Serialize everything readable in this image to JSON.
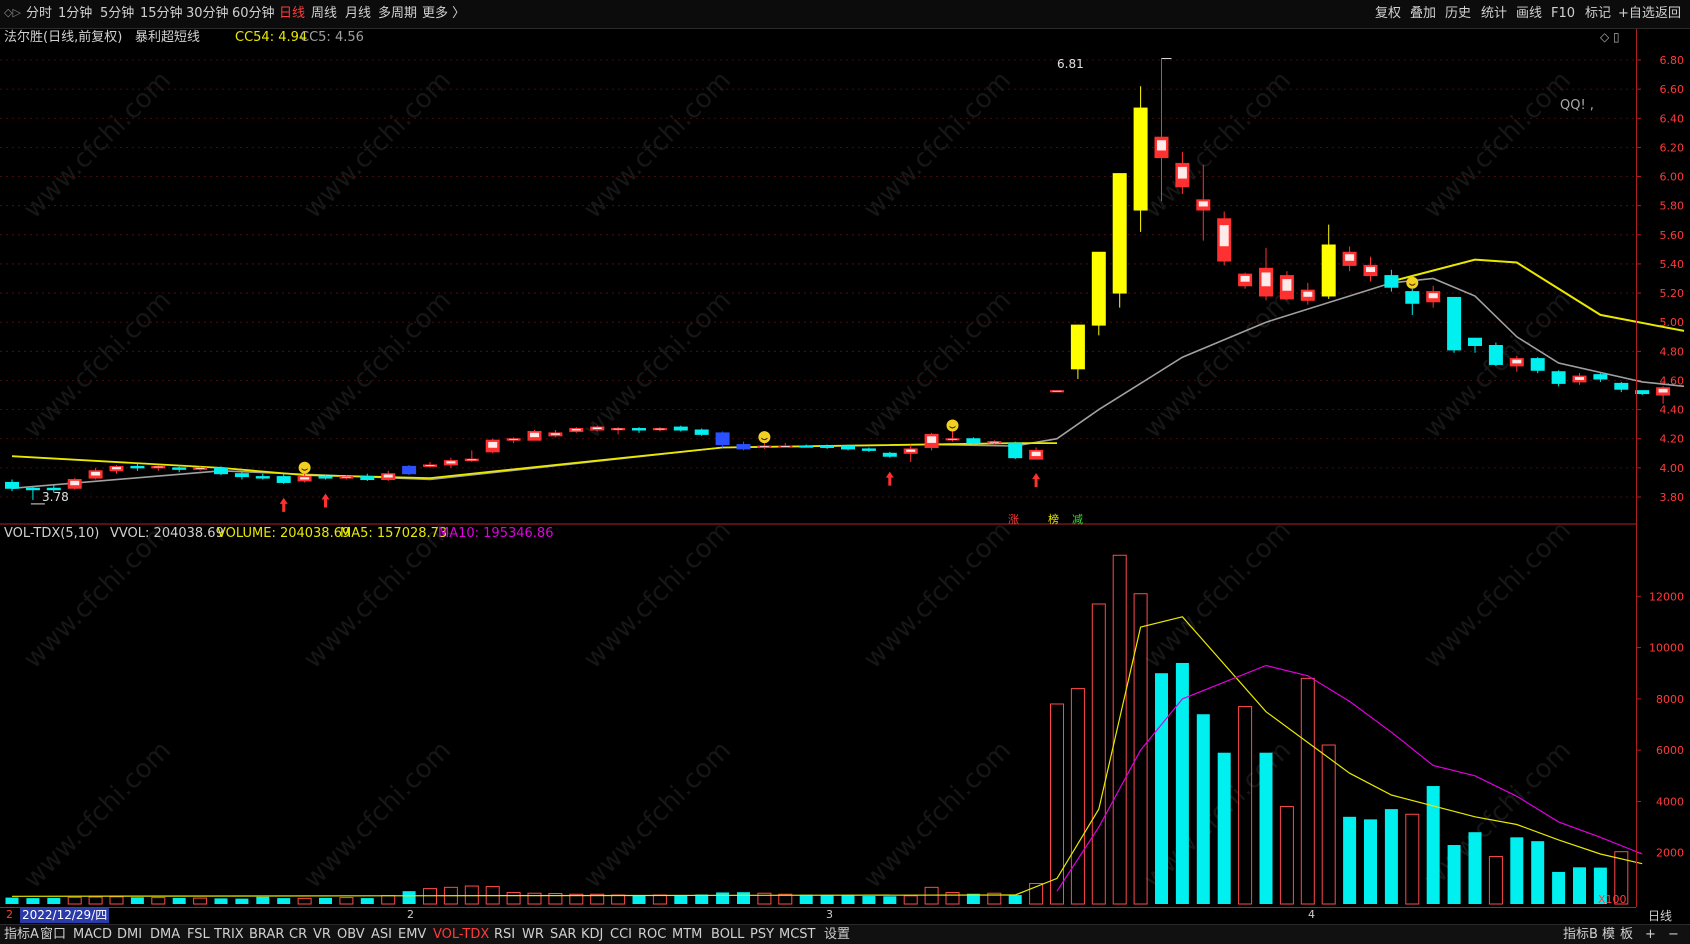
{
  "topbar": {
    "left_toggle": "◇▷",
    "periods": [
      "分时",
      "1分钟",
      "5分钟",
      "15分钟",
      "30分钟",
      "60分钟",
      "日线",
      "周线",
      "月线",
      "多周期",
      "更多 〉"
    ],
    "active_period": "日线",
    "tools": [
      "复权",
      "叠加",
      "历史",
      "统计",
      "画线",
      "F10",
      "标记",
      "+自选",
      "返回"
    ]
  },
  "info": {
    "stock_title": "法尔胜(日线,前复权)",
    "indicator_name": "暴利超短线",
    "cc54_label": "CC54: 4.94",
    "cc5_label": "CC5: 4.56",
    "qq_note": "QQ!  ,",
    "high_label": "6.81",
    "low_label": "3.78",
    "right_icons": "◇ ▯"
  },
  "price_axis": [
    "6.80",
    "6.60",
    "6.40",
    "6.20",
    "6.00",
    "5.80",
    "5.60",
    "5.40",
    "5.20",
    "5.00",
    "4.80",
    "4.60",
    "4.40",
    "4.20",
    "4.00",
    "3.80"
  ],
  "vol_axis": [
    "12000",
    "10000",
    "8000",
    "6000",
    "4000",
    "2000"
  ],
  "vol_unit": "X100",
  "flags": [
    "涨",
    "榜",
    "减"
  ],
  "vol_info": {
    "name": "VOL-TDX(5,10)",
    "vvol": "VVOL: 204038.69",
    "volume": "VOLUME: 204038.69",
    "ma5": "MA5: 157028.73",
    "ma10": "MA10: 195346.86"
  },
  "date_axis": {
    "selected_date": "2022/12/29/四",
    "month_ticks": [
      "2",
      "3",
      "4"
    ],
    "left_mark": "2"
  },
  "bottombar": {
    "items": [
      "指标A",
      "窗口",
      "MACD",
      "DMI",
      "DMA",
      "FSL",
      "TRIX",
      "BRAR",
      "CR",
      "VR",
      "OBV",
      "ASI",
      "EMV",
      "VOL-TDX",
      "RSI",
      "WR",
      "SAR",
      "KDJ",
      "CCI",
      "ROC",
      "MTM",
      "BOLL",
      "PSY",
      "MCST",
      "设置"
    ],
    "active_item": "VOL-TDX",
    "right_items": [
      "指标B",
      "模",
      "板",
      "+",
      "−"
    ],
    "period_label": "日线"
  },
  "watermark": "www.cfchi.com",
  "colors": {
    "up": "#ff3030",
    "down": "#00f0f0",
    "limit_up": "#ffff00",
    "ma_gray": "#a0a0a0",
    "ma_yellow": "#e8e800",
    "ma10_magenta": "#e000e0"
  },
  "chart_data": [
    {
      "type": "candlestick",
      "title": "法尔胜(日线,前复权)",
      "ylim": [
        3.7,
        6.85
      ],
      "candles": [
        [
          3.9,
          3.86,
          3.92,
          3.84,
          "d"
        ],
        [
          3.86,
          3.85,
          3.87,
          3.78,
          "d"
        ],
        [
          3.85,
          3.86,
          3.88,
          3.83,
          "d"
        ],
        [
          3.86,
          3.92,
          3.93,
          3.85,
          "u"
        ],
        [
          3.93,
          3.98,
          4.0,
          3.92,
          "u"
        ],
        [
          3.98,
          4.01,
          4.02,
          3.96,
          "u"
        ],
        [
          4.01,
          4.0,
          4.03,
          3.98,
          "d"
        ],
        [
          4.0,
          4.01,
          4.02,
          3.98,
          "u"
        ],
        [
          4.0,
          3.99,
          4.02,
          3.97,
          "d"
        ],
        [
          3.99,
          4.0,
          4.01,
          3.98,
          "u"
        ],
        [
          4.0,
          3.96,
          4.01,
          3.95,
          "d"
        ],
        [
          3.96,
          3.94,
          3.97,
          3.92,
          "d"
        ],
        [
          3.94,
          3.93,
          3.96,
          3.92,
          "d"
        ],
        [
          3.94,
          3.9,
          3.96,
          3.89,
          "d"
        ],
        [
          3.91,
          3.94,
          3.96,
          3.9,
          "u"
        ],
        [
          3.94,
          3.93,
          3.95,
          3.92,
          "d"
        ],
        [
          3.93,
          3.94,
          3.95,
          3.92,
          "u"
        ],
        [
          3.94,
          3.92,
          3.96,
          3.91,
          "d"
        ],
        [
          3.92,
          3.96,
          3.98,
          3.91,
          "u"
        ],
        [
          3.96,
          4.01,
          4.02,
          3.95,
          "b"
        ],
        [
          4.01,
          4.02,
          4.04,
          4.0,
          "u"
        ],
        [
          4.02,
          4.05,
          4.07,
          4.0,
          "u"
        ],
        [
          4.05,
          4.06,
          4.12,
          4.04,
          "u"
        ],
        [
          4.11,
          4.19,
          4.2,
          4.1,
          "u"
        ],
        [
          4.19,
          4.2,
          4.21,
          4.17,
          "u"
        ],
        [
          4.19,
          4.25,
          4.26,
          4.19,
          "u"
        ],
        [
          4.22,
          4.24,
          4.26,
          4.21,
          "u"
        ],
        [
          4.25,
          4.27,
          4.28,
          4.24,
          "u"
        ],
        [
          4.26,
          4.28,
          4.29,
          4.25,
          "u"
        ],
        [
          4.27,
          4.27,
          4.28,
          4.23,
          "u"
        ],
        [
          4.27,
          4.26,
          4.28,
          4.24,
          "d"
        ],
        [
          4.27,
          4.27,
          4.28,
          4.25,
          "u"
        ],
        [
          4.28,
          4.26,
          4.29,
          4.25,
          "d"
        ],
        [
          4.26,
          4.23,
          4.27,
          4.22,
          "d"
        ],
        [
          4.24,
          4.16,
          4.25,
          4.14,
          "b"
        ],
        [
          4.16,
          4.13,
          4.18,
          4.12,
          "b"
        ],
        [
          4.14,
          4.15,
          4.17,
          4.13,
          "u"
        ],
        [
          4.15,
          4.15,
          4.17,
          4.14,
          "u"
        ],
        [
          4.15,
          4.15,
          4.16,
          4.14,
          "d"
        ],
        [
          4.15,
          4.14,
          4.16,
          4.13,
          "d"
        ],
        [
          4.15,
          4.13,
          4.16,
          4.12,
          "d"
        ],
        [
          4.13,
          4.12,
          4.14,
          4.11,
          "d"
        ],
        [
          4.1,
          4.08,
          4.11,
          4.07,
          "d"
        ],
        [
          4.1,
          4.13,
          4.16,
          4.04,
          "u"
        ],
        [
          4.14,
          4.23,
          4.24,
          4.12,
          "u"
        ],
        [
          4.2,
          4.2,
          4.25,
          4.18,
          "u"
        ],
        [
          4.2,
          4.17,
          4.21,
          4.16,
          "d"
        ],
        [
          4.18,
          4.18,
          4.19,
          4.16,
          "u"
        ],
        [
          4.17,
          4.07,
          4.18,
          4.06,
          "d"
        ],
        [
          4.06,
          4.12,
          4.14,
          4.06,
          "u"
        ],
        [
          4.53,
          4.53,
          4.53,
          4.53,
          "u"
        ],
        [
          4.68,
          4.98,
          4.98,
          4.61,
          "y"
        ],
        [
          4.98,
          5.48,
          5.48,
          4.91,
          "y"
        ],
        [
          5.2,
          6.02,
          6.02,
          5.1,
          "y"
        ],
        [
          5.77,
          6.47,
          6.62,
          5.62,
          "y"
        ],
        [
          6.27,
          6.13,
          6.81,
          5.83,
          "u"
        ],
        [
          6.09,
          5.93,
          6.17,
          5.88,
          "u"
        ],
        [
          5.84,
          5.77,
          6.08,
          5.56,
          "u"
        ],
        [
          5.71,
          5.42,
          5.76,
          5.39,
          "u"
        ],
        [
          5.33,
          5.25,
          5.34,
          5.23,
          "u"
        ],
        [
          5.37,
          5.18,
          5.51,
          5.15,
          "u"
        ],
        [
          5.32,
          5.16,
          5.35,
          5.15,
          "u"
        ],
        [
          5.22,
          5.15,
          5.27,
          5.12,
          "u"
        ],
        [
          5.53,
          5.18,
          5.67,
          5.16,
          "y"
        ],
        [
          5.48,
          5.39,
          5.52,
          5.35,
          "u"
        ],
        [
          5.39,
          5.32,
          5.45,
          5.28,
          "u"
        ],
        [
          5.32,
          5.24,
          5.36,
          5.21,
          "d"
        ],
        [
          5.21,
          5.13,
          5.23,
          5.05,
          "d"
        ],
        [
          5.21,
          5.14,
          5.25,
          5.1,
          "u"
        ],
        [
          5.17,
          4.81,
          5.17,
          4.79,
          "d"
        ],
        [
          4.89,
          4.84,
          4.89,
          4.79,
          "d"
        ],
        [
          4.84,
          4.71,
          4.86,
          4.7,
          "d"
        ],
        [
          4.75,
          4.7,
          4.77,
          4.66,
          "u"
        ],
        [
          4.75,
          4.67,
          4.76,
          4.65,
          "d"
        ],
        [
          4.66,
          4.58,
          4.67,
          4.56,
          "d"
        ],
        [
          4.63,
          4.59,
          4.65,
          4.57,
          "u"
        ],
        [
          4.64,
          4.61,
          4.65,
          4.59,
          "d"
        ],
        [
          4.58,
          4.54,
          4.59,
          4.52,
          "d"
        ],
        [
          4.53,
          4.51,
          4.53,
          4.5,
          "d"
        ],
        [
          4.55,
          4.5,
          4.56,
          4.44,
          "u"
        ]
      ],
      "series": [
        {
          "name": "CC54",
          "values_note": "yellow line"
        },
        {
          "name": "CC5",
          "values_note": "gray line"
        }
      ],
      "cc5_line": [
        [
          0,
          3.86
        ],
        [
          10,
          3.98
        ],
        [
          20,
          3.92
        ],
        [
          34,
          4.14
        ],
        [
          44,
          4.16
        ],
        [
          48,
          4.15
        ],
        [
          50,
          4.2
        ],
        [
          52,
          4.4
        ],
        [
          56,
          4.76
        ],
        [
          60,
          5.0
        ],
        [
          66,
          5.27
        ],
        [
          68,
          5.3
        ],
        [
          70,
          5.18
        ],
        [
          72,
          4.9
        ],
        [
          74,
          4.72
        ],
        [
          78,
          4.59
        ],
        [
          80,
          4.56
        ]
      ],
      "cc54_line": [
        [
          0,
          4.08
        ],
        [
          10,
          4.0
        ],
        [
          14,
          3.95
        ],
        [
          20,
          3.93
        ],
        [
          34,
          4.14
        ],
        [
          48,
          4.17
        ],
        [
          50,
          4.17
        ]
      ],
      "cc54_line2": [
        [
          66,
          5.28
        ],
        [
          70,
          5.43
        ],
        [
          72,
          5.41
        ],
        [
          76,
          5.05
        ],
        [
          80,
          4.94
        ]
      ],
      "markers": {
        "up_arrows": [
          13,
          15,
          42,
          49
        ],
        "smiles": [
          14,
          36,
          45,
          67
        ]
      }
    },
    {
      "type": "bar",
      "title": "VOL-TDX(5,10)",
      "ylim": [
        0,
        14000
      ],
      "volumes": [
        [
          250,
          "d"
        ],
        [
          230,
          "d"
        ],
        [
          240,
          "d"
        ],
        [
          260,
          "u"
        ],
        [
          270,
          "u"
        ],
        [
          280,
          "u"
        ],
        [
          260,
          "d"
        ],
        [
          250,
          "u"
        ],
        [
          240,
          "d"
        ],
        [
          230,
          "u"
        ],
        [
          220,
          "d"
        ],
        [
          210,
          "d"
        ],
        [
          280,
          "d"
        ],
        [
          230,
          "d"
        ],
        [
          220,
          "u"
        ],
        [
          240,
          "d"
        ],
        [
          250,
          "u"
        ],
        [
          230,
          "d"
        ],
        [
          330,
          "u"
        ],
        [
          500,
          "b"
        ],
        [
          600,
          "u"
        ],
        [
          650,
          "u"
        ],
        [
          700,
          "u"
        ],
        [
          680,
          "u"
        ],
        [
          450,
          "u"
        ],
        [
          420,
          "u"
        ],
        [
          410,
          "u"
        ],
        [
          380,
          "u"
        ],
        [
          380,
          "u"
        ],
        [
          350,
          "u"
        ],
        [
          350,
          "d"
        ],
        [
          350,
          "u"
        ],
        [
          340,
          "d"
        ],
        [
          370,
          "d"
        ],
        [
          450,
          "b"
        ],
        [
          460,
          "b"
        ],
        [
          420,
          "u"
        ],
        [
          380,
          "u"
        ],
        [
          360,
          "d"
        ],
        [
          340,
          "d"
        ],
        [
          350,
          "d"
        ],
        [
          310,
          "d"
        ],
        [
          300,
          "d"
        ],
        [
          320,
          "u"
        ],
        [
          650,
          "u"
        ],
        [
          450,
          "u"
        ],
        [
          400,
          "d"
        ],
        [
          420,
          "u"
        ],
        [
          350,
          "d"
        ],
        [
          800,
          "u"
        ],
        [
          7800,
          "u"
        ],
        [
          8400,
          "y"
        ],
        [
          11700,
          "y"
        ],
        [
          13600,
          "y"
        ],
        [
          12100,
          "u"
        ],
        [
          9000,
          "d"
        ],
        [
          9400,
          "d"
        ],
        [
          7400,
          "d"
        ],
        [
          5900,
          "d"
        ],
        [
          7700,
          "u"
        ],
        [
          5900,
          "d"
        ],
        [
          3800,
          "u"
        ],
        [
          8800,
          "y"
        ],
        [
          6200,
          "u"
        ],
        [
          3400,
          "d"
        ],
        [
          3300,
          "d"
        ],
        [
          3700,
          "d"
        ],
        [
          3500,
          "u"
        ],
        [
          4600,
          "d"
        ],
        [
          2300,
          "d"
        ],
        [
          2800,
          "d"
        ],
        [
          1850,
          "u"
        ],
        [
          2600,
          "d"
        ],
        [
          2450,
          "d"
        ],
        [
          1250,
          "d"
        ],
        [
          1430,
          "d"
        ],
        [
          1420,
          "d"
        ],
        [
          2040,
          "u"
        ]
      ],
      "ma5": [
        [
          0,
          300
        ],
        [
          48,
          350
        ],
        [
          50,
          1000
        ],
        [
          52,
          3700
        ],
        [
          54,
          10800
        ],
        [
          56,
          11200
        ],
        [
          60,
          7500
        ],
        [
          62,
          6300
        ],
        [
          64,
          5100
        ],
        [
          66,
          4250
        ],
        [
          70,
          3400
        ],
        [
          72,
          3100
        ],
        [
          74,
          2500
        ],
        [
          76,
          1950
        ],
        [
          78,
          1570
        ]
      ],
      "ma10": [
        [
          50,
          500
        ],
        [
          52,
          3000
        ],
        [
          54,
          6000
        ],
        [
          56,
          8000
        ],
        [
          60,
          9300
        ],
        [
          62,
          8900
        ],
        [
          64,
          7900
        ],
        [
          66,
          6700
        ],
        [
          68,
          5400
        ],
        [
          70,
          5000
        ],
        [
          72,
          4200
        ],
        [
          74,
          3200
        ],
        [
          76,
          2600
        ],
        [
          78,
          1950
        ]
      ]
    }
  ]
}
